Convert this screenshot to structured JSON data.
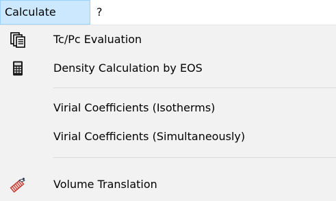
{
  "menubar": {
    "items": [
      {
        "label": "Calculate"
      },
      {
        "label": "?"
      }
    ]
  },
  "menu": {
    "items": [
      {
        "label": "Tc/Pc Evaluation",
        "icon": "documents-icon"
      },
      {
        "label": "Density Calculation by EOS",
        "icon": "calculator-icon"
      },
      {
        "label": "Virial Coefficients (Isotherms)"
      },
      {
        "label": "Virial Coefficients (Simultaneously)"
      },
      {
        "label": "Volume Translation",
        "icon": "volume-translation-icon"
      }
    ]
  }
}
